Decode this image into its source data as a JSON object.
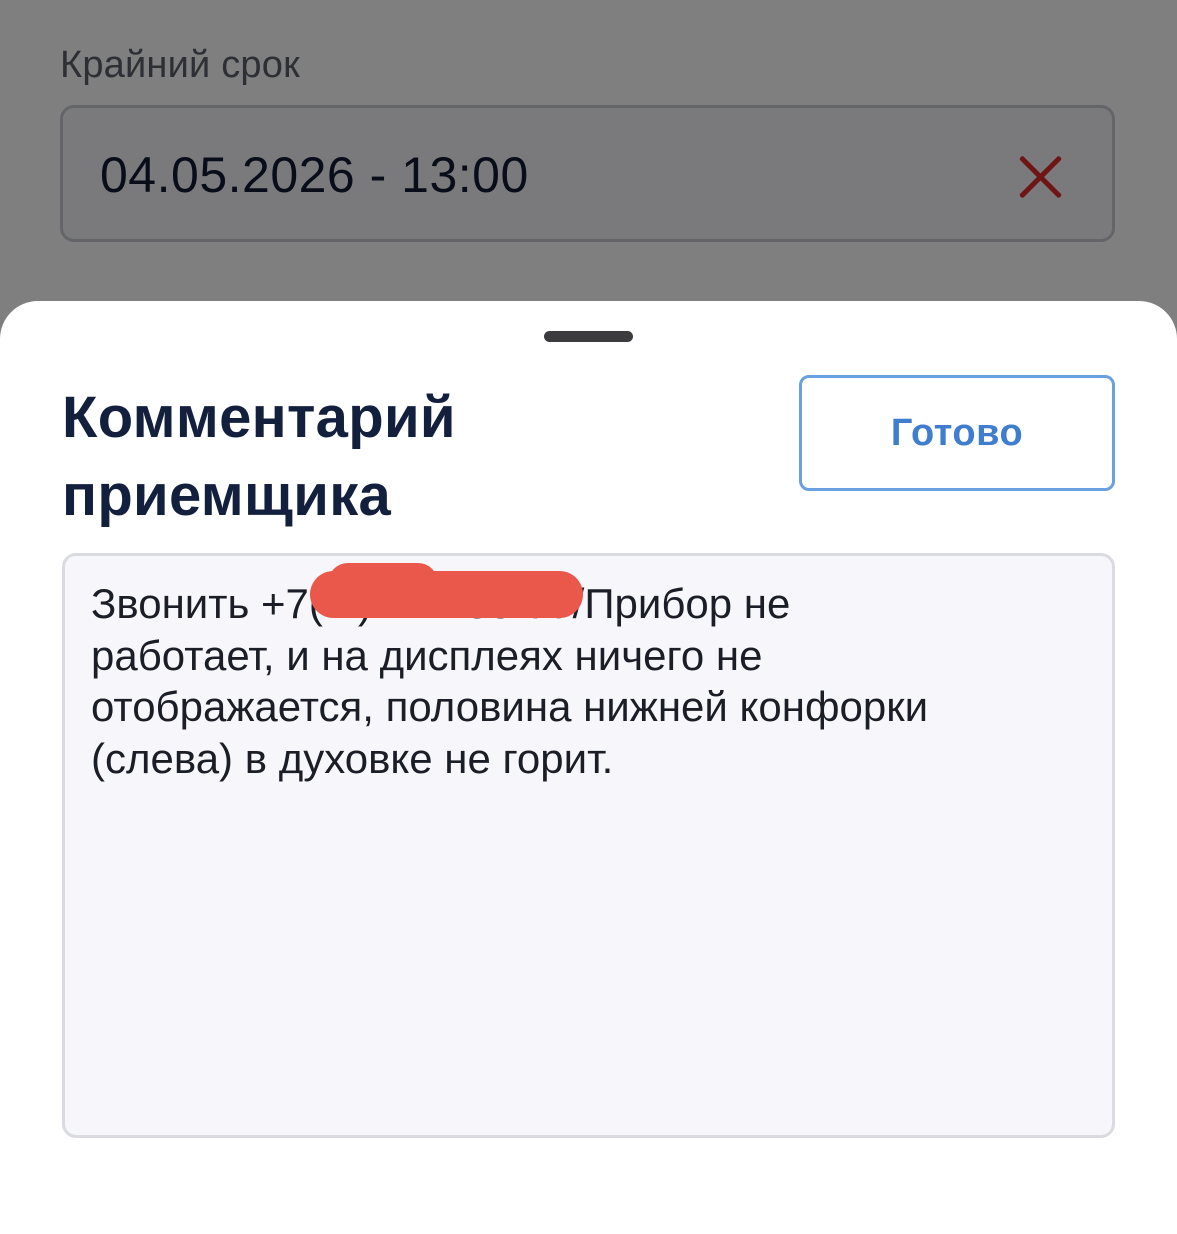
{
  "background_form": {
    "deadline_label": "Крайний срок",
    "deadline_value": "04.05.2026 - 13:00",
    "clear_icon": "close-icon",
    "clear_icon_color": "#e12a2a"
  },
  "sheet": {
    "title": "Комментарий приемщика",
    "done_label": "Готово",
    "comment_value": "Звонить +7(   )        33-77/Прибор не\nработает, и на дисплеях ничего не\nотображается, половина нижней конфорки\n(слева) в духовке не горит.",
    "accent_color": "#3f7dcf",
    "redaction_color": "#e9584a"
  }
}
